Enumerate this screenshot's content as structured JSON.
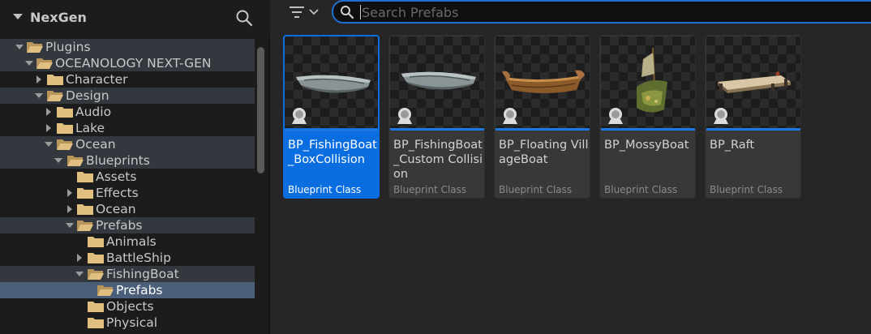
{
  "left_panel": {
    "title": "NexGen",
    "tree": [
      {
        "label": "Plugins",
        "state": "open"
      },
      {
        "label": "OCEANOLOGY NEXT-GEN",
        "state": "open"
      },
      {
        "label": "Character",
        "state": "closed"
      },
      {
        "label": "Design",
        "state": "open"
      },
      {
        "label": "Audio",
        "state": "closed"
      },
      {
        "label": "Lake",
        "state": "closed"
      },
      {
        "label": "Ocean",
        "state": "open"
      },
      {
        "label": "Blueprints",
        "state": "open"
      },
      {
        "label": "Assets",
        "state": "none"
      },
      {
        "label": "Effects",
        "state": "closed"
      },
      {
        "label": "Ocean",
        "state": "closed"
      },
      {
        "label": "Prefabs",
        "state": "open"
      },
      {
        "label": "Animals",
        "state": "none"
      },
      {
        "label": "BattleShip",
        "state": "closed"
      },
      {
        "label": "FishingBoat",
        "state": "open"
      },
      {
        "label": "Prefabs",
        "state": "none"
      },
      {
        "label": "Objects",
        "state": "none"
      },
      {
        "label": "Physical",
        "state": "none"
      }
    ]
  },
  "toolbar": {
    "search_placeholder": "Search Prefabs",
    "search_value": ""
  },
  "assets": [
    {
      "name": "BP_FishingBoat_BoxCollision",
      "type": "Blueprint Class",
      "selected": true,
      "icon": "fishing-boat-thumbnail"
    },
    {
      "name": "BP_FishingBoat_Custom Collision",
      "type": "Blueprint Class",
      "selected": false,
      "icon": "fishing-boat-thumbnail"
    },
    {
      "name": "BP_Floating VillageBoat",
      "type": "Blueprint Class",
      "selected": false,
      "icon": "village-boat-thumbnail"
    },
    {
      "name": "BP_MossyBoat",
      "type": "Blueprint Class",
      "selected": false,
      "icon": "mossy-boat-thumbnail"
    },
    {
      "name": "BP_Raft",
      "type": "Blueprint Class",
      "selected": false,
      "icon": "raft-thumbnail"
    }
  ],
  "colors": {
    "accent": "#0a6ee0",
    "selection_row": "#4c5f7a",
    "panel_bg": "#1c1c1c",
    "content_bg": "#262626"
  }
}
